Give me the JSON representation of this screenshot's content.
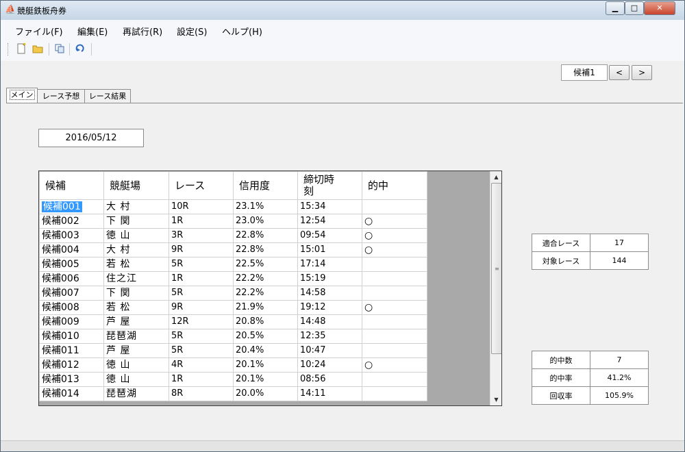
{
  "window": {
    "title": "競艇鉄板舟券",
    "icon": "app-icon",
    "controls": {
      "minimize": "▁",
      "maximize": "□",
      "close": "✕"
    }
  },
  "menu": [
    "ファイル(F)",
    "編集(E)",
    "再試行(R)",
    "設定(S)",
    "ヘルプ(H)"
  ],
  "toolbar": {
    "icons": [
      "new-file-icon",
      "open-folder-icon",
      "copy-icon",
      "refresh-icon"
    ]
  },
  "nav": {
    "candidate_label": "候補1",
    "prev": "<",
    "next": ">"
  },
  "tabs": [
    "メイン",
    "レース予想",
    "レース結果"
  ],
  "main": {
    "date": "2016/05/12",
    "grid": {
      "headers": [
        "候補",
        "競艇場",
        "レース",
        "信用度",
        "締切時\n刻",
        "的中"
      ],
      "rows": [
        [
          "候補001",
          "大 村",
          "10R",
          "23.1%",
          "15:34",
          ""
        ],
        [
          "候補002",
          "下 関",
          " 1R",
          "23.0%",
          "12:54",
          "○"
        ],
        [
          "候補003",
          "徳 山",
          "3R",
          "22.8%",
          "09:54",
          "○"
        ],
        [
          "候補004",
          "大 村",
          "9R",
          "22.8%",
          "15:01",
          "○"
        ],
        [
          "候補005",
          "若 松",
          "5R",
          "22.5%",
          "17:14",
          ""
        ],
        [
          "候補006",
          "住之江",
          " 1R",
          "22.2%",
          "15:19",
          ""
        ],
        [
          "候補007",
          "下 関",
          "5R",
          "22.2%",
          "14:58",
          ""
        ],
        [
          "候補008",
          "若 松",
          "9R",
          "21.9%",
          "19:12",
          "○"
        ],
        [
          "候補009",
          "芦 屋",
          "12R",
          "20.8%",
          "14:48",
          ""
        ],
        [
          "候補010",
          "琵琶湖",
          "5R",
          "20.5%",
          "12:35",
          ""
        ],
        [
          "候補011",
          "芦 屋",
          "5R",
          "20.4%",
          "10:47",
          ""
        ],
        [
          "候補012",
          "徳 山",
          "4R",
          "20.1%",
          "10:24",
          "○"
        ],
        [
          "候補013",
          "徳 山",
          " 1R",
          "20.1%",
          "08:56",
          ""
        ],
        [
          "候補014",
          "琵琶湖",
          "8R",
          "20.0%",
          "14:11",
          ""
        ]
      ]
    },
    "stats_top": [
      {
        "label": "適合レース",
        "value": "17"
      },
      {
        "label": "対象レース",
        "value": "144"
      }
    ],
    "stats_bottom": [
      {
        "label": "的中数",
        "value": "7"
      },
      {
        "label": "的中率",
        "value": "41.2%"
      },
      {
        "label": "回収率",
        "value": "105.9%"
      }
    ]
  }
}
